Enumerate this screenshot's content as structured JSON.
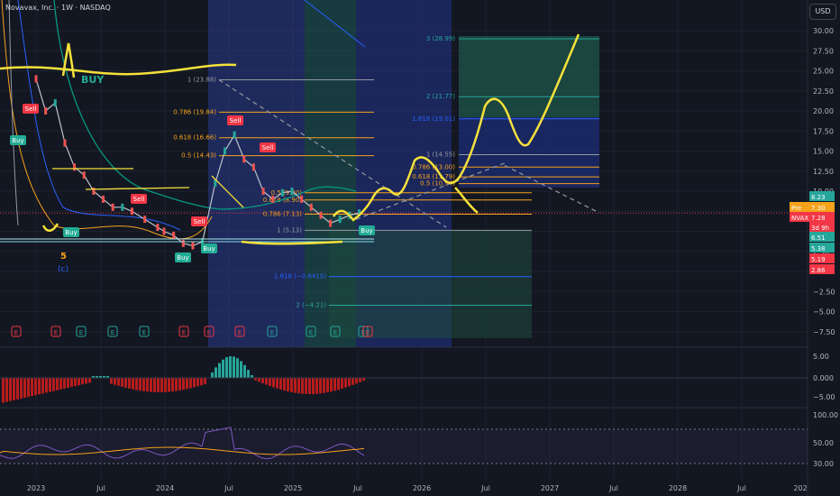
{
  "header": {
    "title": "Novavax, Inc. · 1W · NASDAQ",
    "currency": "USD"
  },
  "price_axis": {
    "ticks": [
      "30.00",
      "27.50",
      "25.00",
      "22.50",
      "20.00",
      "17.50",
      "15.00",
      "12.50",
      "10.00",
      "7.50",
      "5.00",
      "2.50",
      "0.00",
      "−2.50",
      "−5.00",
      "−7.50"
    ],
    "macd_ticks": [
      "5.00",
      "0.000",
      "−5.00"
    ],
    "rsi_ticks": [
      "100.00",
      "50.00",
      "30.00"
    ]
  },
  "time_axis": [
    "2023",
    "Jul",
    "2024",
    "Jul",
    "2025",
    "Jul",
    "2026",
    "Jul",
    "2027",
    "Jul",
    "2028",
    "Jul",
    "202"
  ],
  "price_tags": [
    {
      "label": "",
      "value": "8.23",
      "color": "#26a69a"
    },
    {
      "label": "Pre",
      "value": "7.30",
      "color": "#f7a21b"
    },
    {
      "label": "NVAX",
      "value": "7.28",
      "sub": "3d 9h",
      "color": "#f23645"
    },
    {
      "label": "",
      "value": "6.51",
      "color": "#26a69a"
    },
    {
      "label": "",
      "value": "5.38",
      "color": "#26a69a"
    },
    {
      "label": "",
      "value": "5.19",
      "color": "#f23645"
    },
    {
      "label": "",
      "value": "2.86",
      "color": "#f23645"
    }
  ],
  "fib_left": [
    "1 (23.88)",
    "0.786 (19.84)",
    "0.618 (16.66)",
    "0.5 (14.43)",
    "0.5 (9.80)",
    "0.618 (8.90)",
    "0.786 (7.13)",
    "1 (5.13)",
    "1.618 (−0.6415)",
    "2 (−4.21)"
  ],
  "fib_right": [
    "3 (28.99)",
    "2 (21.77)",
    "1.618 (19.01)",
    "1 (14.55)",
    "0.786 (13.00)",
    "0.618 (11.79)",
    "0.5 (10.94)"
  ],
  "annotations": {
    "buy_big": "BUY",
    "wave_num": "5",
    "wave_label": "(c)"
  },
  "signals": [
    {
      "text": "Buy",
      "type": "buy"
    },
    {
      "text": "Sell",
      "type": "sell"
    },
    {
      "text": "Buy",
      "type": "buy"
    },
    {
      "text": "Sell",
      "type": "sell"
    },
    {
      "text": "Buy",
      "type": "buy"
    },
    {
      "text": "Buy",
      "type": "buy"
    },
    {
      "text": "Sell",
      "type": "sell"
    },
    {
      "text": "Sell",
      "type": "sell"
    },
    {
      "text": "Sell",
      "type": "sell"
    },
    {
      "text": "Buy",
      "type": "buy"
    }
  ],
  "earnings_marker": "E",
  "chart_data": {
    "type": "line",
    "title": "Novavax, Inc. · 1W · NASDAQ",
    "x_ticks": [
      "2023",
      "Jul",
      "2024",
      "Jul",
      "2025",
      "Jul",
      "2026",
      "Jul",
      "2027",
      "Jul",
      "2028",
      "Jul",
      "202"
    ],
    "ylim": [
      -8.5,
      32
    ],
    "last_price": 7.28,
    "series": [
      {
        "name": "NVAX",
        "x": [
          0,
          0.3,
          0.6,
          0.9,
          1.2,
          1.5,
          1.8,
          2.1,
          2.4,
          2.7,
          3.0,
          3.4,
          3.8,
          4.0,
          4.3,
          4.6,
          4.9,
          5.2,
          5.6,
          5.9,
          6.2,
          6.5,
          6.8,
          7.1,
          7.4,
          7.7,
          8.0,
          8.3,
          8.6,
          8.9,
          9.2,
          9.5,
          9.8,
          10.1
        ],
        "y": [
          24,
          20,
          21,
          16,
          13,
          12,
          10,
          9,
          8,
          8,
          7.5,
          6.5,
          5.5,
          5,
          4.5,
          3.5,
          3.2,
          3.7,
          11,
          15,
          17,
          14,
          13,
          10,
          9,
          9.8,
          10,
          9,
          8,
          7,
          6,
          6.5,
          7,
          7.3
        ]
      }
    ],
    "annotations": [
      "fib retracement 1 (23.88) to 0 (5.13)",
      "projected path to 3 (28.99)"
    ]
  }
}
